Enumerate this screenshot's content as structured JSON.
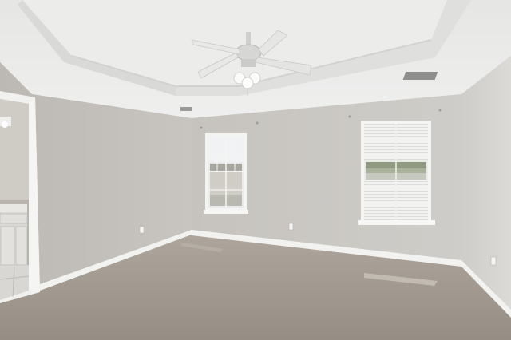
{
  "scene": {
    "kind": "photo",
    "subject": "empty-bedroom-interior"
  },
  "palette": {
    "ceiling": "#e9e9e8",
    "ceiling_shadow": "#dcdcdb",
    "wall_back": "#c9c6c1",
    "wall_left": "#c3c0bb",
    "wall_right": "#d3d1cd",
    "trim": "#f4f4f2",
    "carpet": "#a79f95",
    "carpet_dark": "#8f877d",
    "window_glass": "#e6e8ea",
    "doorway_room": "#b8b4ad",
    "cabinet": "#dadad8"
  }
}
